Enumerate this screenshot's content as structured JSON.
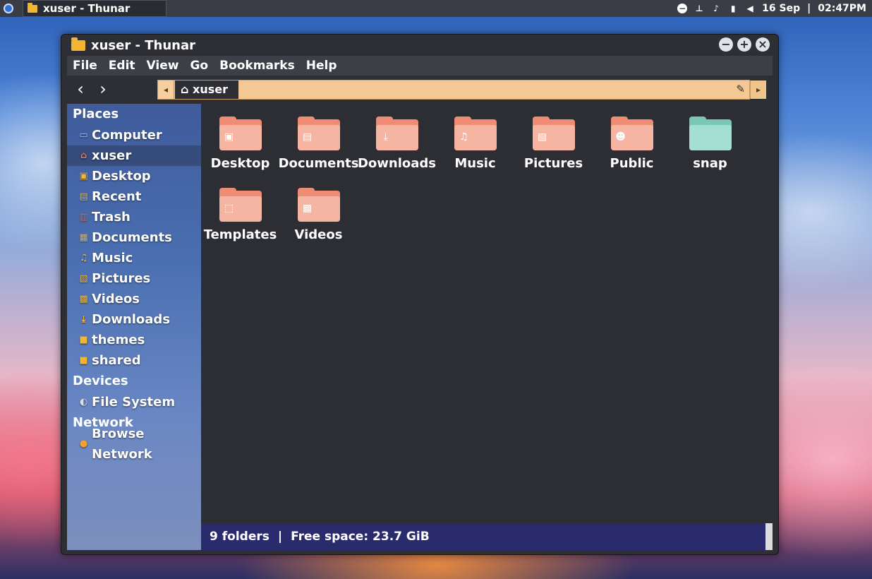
{
  "panel": {
    "task_title": "xuser - Thunar",
    "date": "16 Sep",
    "separator": "|",
    "time": "02:47PM"
  },
  "window": {
    "title": "xuser - Thunar",
    "buttons": {
      "minimize": "−",
      "maximize": "+",
      "close": "×"
    }
  },
  "menubar": [
    "File",
    "Edit",
    "View",
    "Go",
    "Bookmarks",
    "Help"
  ],
  "toolbar": {
    "back": "‹",
    "forward": "›",
    "path_left": "◂",
    "path_right": "▸",
    "crumb": "xuser"
  },
  "sidebar": {
    "places_header": "Places",
    "places": [
      {
        "label": "Computer",
        "icon": "computer-icon",
        "color": "#7fb0e8"
      },
      {
        "label": "xuser",
        "icon": "home-icon",
        "color": "#e8744a"
      },
      {
        "label": "Desktop",
        "icon": "desktop-icon",
        "color": "#f2b634"
      },
      {
        "label": "Recent",
        "icon": "recent-icon",
        "color": "#f2b634"
      },
      {
        "label": "Trash",
        "icon": "trash-icon",
        "color": "#e36a5a"
      },
      {
        "label": "Documents",
        "icon": "documents-icon",
        "color": "#f2b634"
      },
      {
        "label": "Music",
        "icon": "music-icon",
        "color": "#f2b634"
      },
      {
        "label": "Pictures",
        "icon": "pictures-icon",
        "color": "#f2b634"
      },
      {
        "label": "Videos",
        "icon": "videos-icon",
        "color": "#f2b634"
      },
      {
        "label": "Downloads",
        "icon": "downloads-icon",
        "color": "#f2b634"
      },
      {
        "label": "themes",
        "icon": "folder-icon",
        "color": "#f2b634"
      },
      {
        "label": "shared",
        "icon": "folder-icon",
        "color": "#f2b634"
      }
    ],
    "devices_header": "Devices",
    "devices": [
      {
        "label": "File System",
        "icon": "drive-icon"
      }
    ],
    "network_header": "Network",
    "network": [
      {
        "label": "Browse Network",
        "icon": "network-icon"
      }
    ]
  },
  "folders": [
    {
      "label": "Desktop",
      "icon": "desktop-icon"
    },
    {
      "label": "Documents",
      "icon": "documents-icon"
    },
    {
      "label": "Downloads",
      "icon": "downloads-icon"
    },
    {
      "label": "Music",
      "icon": "music-icon"
    },
    {
      "label": "Pictures",
      "icon": "pictures-icon"
    },
    {
      "label": "Public",
      "icon": "public-icon"
    },
    {
      "label": "snap",
      "icon": "folder-icon"
    },
    {
      "label": "Templates",
      "icon": "templates-icon"
    },
    {
      "label": "Videos",
      "icon": "videos-icon"
    }
  ],
  "status": {
    "count": "9 folders",
    "separator": "|",
    "free_space": "Free space: 23.7 GiB"
  }
}
